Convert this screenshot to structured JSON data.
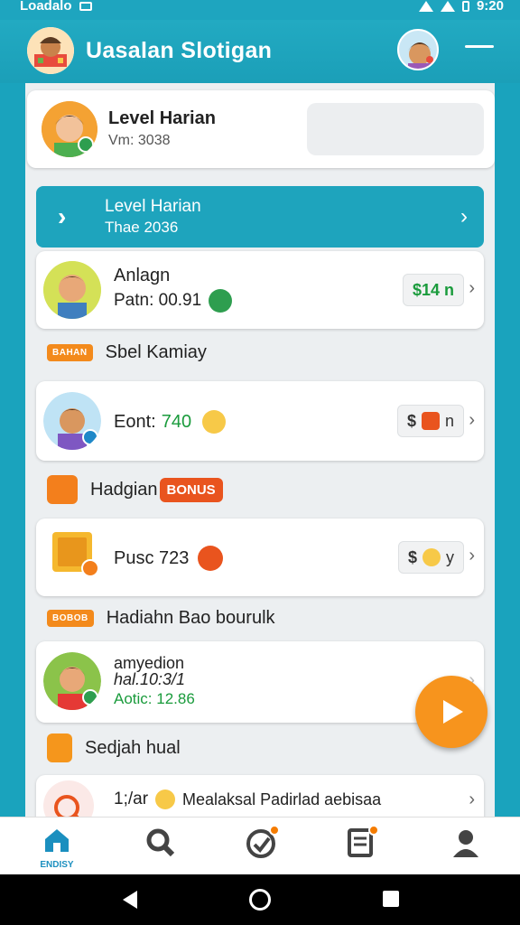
{
  "status_bar": {
    "left_text": "Loadalo",
    "time": "9:20"
  },
  "app_bar": {
    "title": "Uasalan Slotigan"
  },
  "top_card": {
    "title": "Level Harian",
    "subtitle": "Vm: 3038"
  },
  "banner": {
    "title": "Level Harian",
    "subtitle": "Thae 2036"
  },
  "rows": [
    {
      "name": "Anlagn",
      "sub": "Patn: 00.91",
      "pill": "$14 n"
    },
    {
      "name": "Eont:",
      "value": "740",
      "pill_prefix": "$",
      "pill_suffix": "n"
    },
    {
      "name": "Pusc 723",
      "pill_prefix": "$",
      "pill_suffix": "y"
    },
    {
      "name": "amyedion",
      "sub1": "hal.10:3/1",
      "sub2": "Aotic: 12.86"
    },
    {
      "name": "1;/ar",
      "extra": "Mealaksal Padirlad aebisaa"
    }
  ],
  "sections": [
    {
      "tag": "BAHAN",
      "label": "Sbel Kamiay"
    },
    {
      "label": "Hadgian",
      "badge": "BONUS"
    },
    {
      "tag": "BOBOB",
      "label": "Hadiahn Bao bourulk"
    },
    {
      "label": "Sedjah hual"
    }
  ],
  "bottom_nav": {
    "home_label": "ENDISY"
  },
  "colors": {
    "primary": "#1ea5bf",
    "accent": "#f7941d",
    "money_green": "#1a9b3c"
  }
}
